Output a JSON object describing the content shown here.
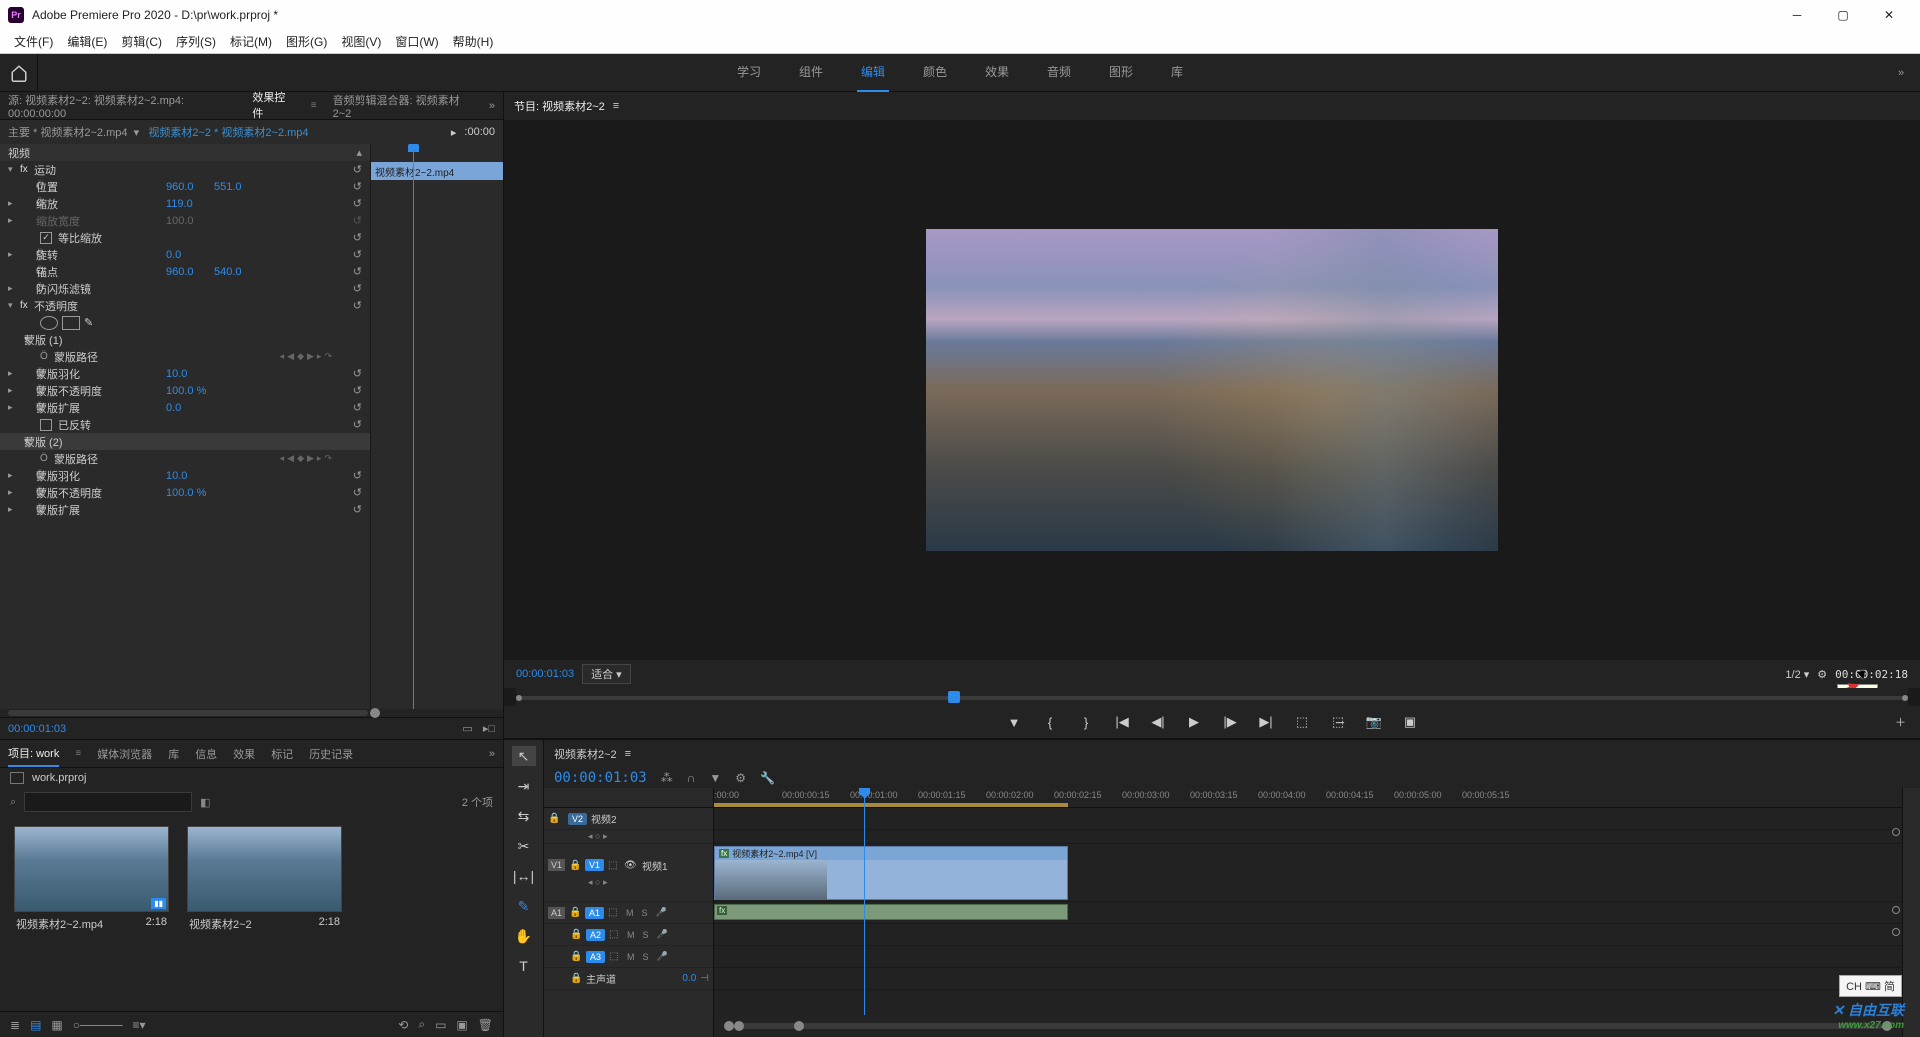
{
  "app": {
    "title": "Adobe Premiere Pro 2020 - D:\\pr\\work.prproj *"
  },
  "menu": {
    "file": "文件(F)",
    "edit": "编辑(E)",
    "clip": "剪辑(C)",
    "sequence": "序列(S)",
    "markers": "标记(M)",
    "graphics": "图形(G)",
    "view": "视图(V)",
    "window": "窗口(W)",
    "help": "帮助(H)"
  },
  "workspaces": {
    "learn": "学习",
    "assembly": "组件",
    "editing": "编辑",
    "color": "颜色",
    "effects": "效果",
    "audio": "音频",
    "graphics": "图形",
    "library": "库"
  },
  "sourceTabs": {
    "source": "源: 视频素材2~2: 视频素材2~2.mp4: 00:00:00:00",
    "effectControls": "效果控件",
    "audioMixer": "音频剪辑混合器: 视频素材2~2"
  },
  "ec": {
    "crumb_main": "主要 * 视频素材2~2.mp4",
    "crumb_clip": "视频素材2~2 * 视频素材2~2.mp4",
    "tl_start": ":00:00",
    "mini_clip": "视频素材2~2.mp4",
    "video_header": "视频",
    "motion": "运动",
    "position": "位置",
    "pos_x": "960.0",
    "pos_y": "551.0",
    "scale": "缩放",
    "scale_v": "119.0",
    "scale_w": "缩放宽度",
    "scale_w_v": "100.0",
    "uniform": "等比缩放",
    "rotation": "旋转",
    "rotation_v": "0.0",
    "anchor": "锚点",
    "anchor_x": "960.0",
    "anchor_y": "540.0",
    "flicker": "防闪烁滤镜",
    "opacity": "不透明度",
    "mask1": "蒙版 (1)",
    "mask2": "蒙版 (2)",
    "mask_path": "蒙版路径",
    "mask_feather": "蒙版羽化",
    "mask_feather_v": "10.0",
    "mask_opacity": "蒙版不透明度",
    "mask_opacity_v": "100.0 %",
    "mask_expand": "蒙版扩展",
    "mask_expand_v": "0.0",
    "inverted": "已反转",
    "footer_tc": "00:00:01:03"
  },
  "program": {
    "title": "节目: 视频素材2~2",
    "tc_left": "00:00:01:03",
    "fit": "适合",
    "res": "1/2",
    "tc_right": "00:00:02:18",
    "tooltip": "设置..."
  },
  "projTabs": {
    "project": "项目: work",
    "media": "媒体浏览器",
    "library": "库",
    "info": "信息",
    "effects": "效果",
    "markers": "标记",
    "history": "历史记录"
  },
  "project": {
    "name": "work.prproj",
    "search_placeholder": "",
    "count": "2 个项",
    "items": [
      {
        "name": "视频素材2~2.mp4",
        "dur": "2:18"
      },
      {
        "name": "视频素材2~2",
        "dur": "2:18"
      }
    ]
  },
  "timeline": {
    "seq_name": "视频素材2~2",
    "tc": "00:00:01:03",
    "ticks": [
      ":00:00",
      "00:00:00:15",
      "00:00:01:00",
      "00:00:01:15",
      "00:00:02:00",
      "00:00:02:15",
      "00:00:03:00",
      "00:00:03:15",
      "00:00:04:00",
      "00:00:04:15",
      "00:00:05:00",
      "00:00:05:15"
    ],
    "v2": "视频2",
    "v1": "视频1",
    "v1_label": "V1",
    "v2_label": "V2",
    "a1_label": "A1",
    "a2_label": "A2",
    "a3_label": "A3",
    "master": "主声道",
    "master_v": "0.0",
    "clip_name": "视频素材2~2.mp4 [V]"
  },
  "ime": "CH ⌨ 简"
}
